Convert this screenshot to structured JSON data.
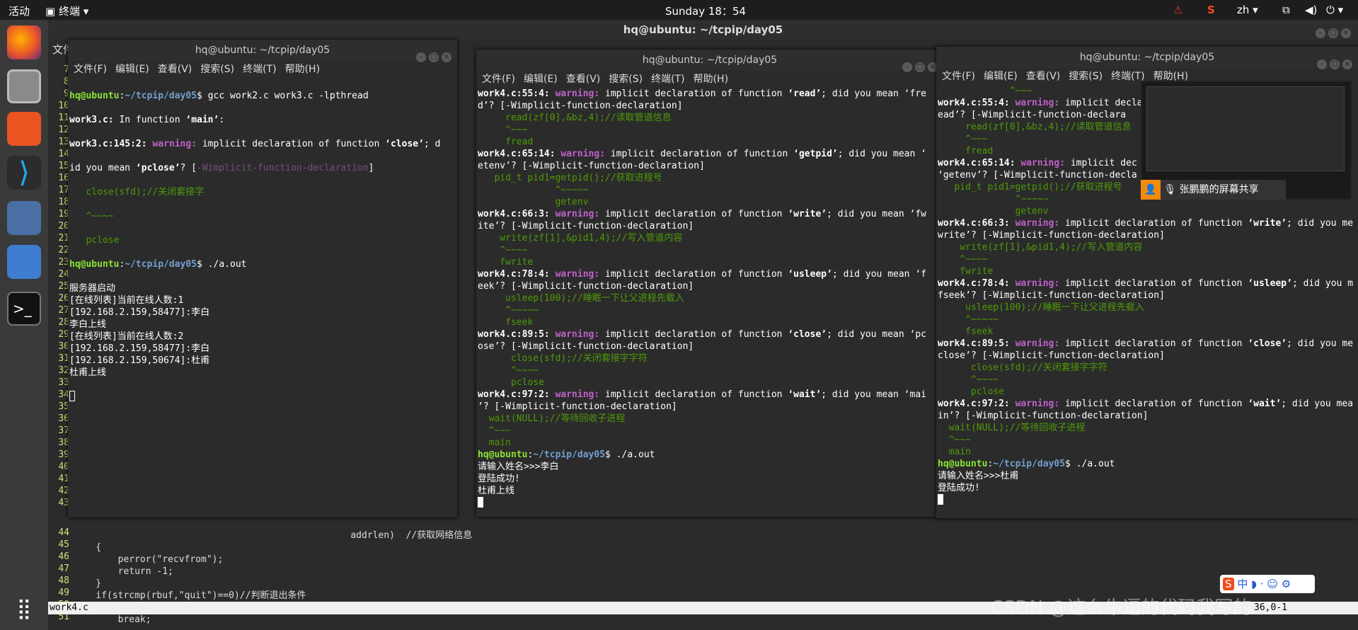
{
  "topbar": {
    "activities": "活动",
    "app": "终端",
    "clock": "Sunday 18：54",
    "lang": "zh"
  },
  "bg": {
    "title": "hq@ubuntu: ~/tcpip/day05",
    "menu_fragment": "文件",
    "status_file": "work4.c",
    "status_pos": "36,0-1",
    "gutter_top": [
      "7",
      "8",
      "9",
      "10",
      "11",
      "12",
      "13",
      "14",
      "15",
      "16",
      "17",
      "18",
      "19",
      "20",
      "21",
      "22",
      "23",
      "24",
      "25",
      "26",
      "27",
      "28",
      "29",
      "30",
      "31",
      "32",
      "33",
      "34",
      "35",
      "36",
      "37",
      "38",
      "39",
      "40",
      "41",
      "42",
      "43"
    ],
    "gutter_bottom": [
      "44",
      "45",
      "46",
      "47",
      "48",
      "49",
      "50",
      "51"
    ],
    "code": [
      "                                                  addrlen)  //获取网络信息",
      "    {",
      "        perror(\"recvfrom\");",
      "        return -1;",
      "    }",
      "    if(strcmp(rbuf,\"quit\")==0)//判断退出条件",
      "    {",
      "        break;"
    ]
  },
  "menu": [
    "文件(F)",
    "编辑(E)",
    "查看(V)",
    "搜索(S)",
    "终端(T)",
    "帮助(H)"
  ],
  "win1": {
    "title": "hq@ubuntu: ~/tcpip/day05",
    "prompt_user": "hq@ubuntu",
    "prompt_path": "~/tcpip/day05",
    "cmd1": "$ gcc work2.c work3.c -lpthread",
    "l2a": "work3.c:",
    "l2b": " In function ",
    "l2c": "‘main’",
    "l3a": "work3.c:145:2:",
    "l3b": " warning:",
    "l3c": " implicit declaration of function ",
    "l3d": "‘close’",
    "l3e": "; d",
    "l4a": "id you mean ",
    "l4b": "‘pclose’",
    "l4c": "? [",
    "l4d": "-Wimplicit-function-declaration",
    "l4e": "]",
    "l5": "   close(sfd);//关闭套接字",
    "l6": "   ^~~~~",
    "l7": "   pclose",
    "cmd2": "$ ./a.out",
    "out": [
      "服务器启动",
      "[在线列表]当前在线人数:1",
      "[192.168.2.159,58477]:李白",
      "李白上线",
      "[在线列表]当前在线人数:2",
      "[192.168.2.159,58477]:李白",
      "[192.168.2.159,50674]:杜甫",
      "杜甫上线"
    ]
  },
  "win2": {
    "title": "hq@ubuntu: ~/tcpip/day05",
    "lines": [
      {
        "a": "work4.c:55:4:",
        "b": " warning:",
        "c": " implicit declaration of function ",
        "d": "‘read’",
        "e": "; did you mean ‘fre"
      },
      {
        "t": "d’? [-Wimplicit-function-declaration]"
      },
      {
        "t": "     read(zf[0],&bz,4);//读取管道信息"
      },
      {
        "t": "     ^~~~"
      },
      {
        "t": "     fread"
      },
      {
        "a": "work4.c:65:14:",
        "b": " warning:",
        "c": " implicit declaration of function ",
        "d": "‘getpid’",
        "e": "; did you mean ‘"
      },
      {
        "t": "etenv’? [-Wimplicit-function-declaration]"
      },
      {
        "t": "   pid_t pid1=getpid();//获取进程号"
      },
      {
        "t": "              ^~~~~~"
      },
      {
        "t": "              getenv"
      },
      {
        "a": "work4.c:66:3:",
        "b": " warning:",
        "c": " implicit declaration of function ",
        "d": "‘write’",
        "e": "; did you mean ‘fw"
      },
      {
        "t": "ite’? [-Wimplicit-function-declaration]"
      },
      {
        "t": "    write(zf[1],&pid1,4);//写入管道内容"
      },
      {
        "t": "    ^~~~~"
      },
      {
        "t": "    fwrite"
      },
      {
        "a": "work4.c:78:4:",
        "b": " warning:",
        "c": " implicit declaration of function ",
        "d": "‘usleep’",
        "e": "; did you mean ‘f"
      },
      {
        "t": "eek’? [-Wimplicit-function-declaration]"
      },
      {
        "t": "     usleep(100);//睡眠一下让父进程先载入"
      },
      {
        "t": "     ^~~~~~"
      },
      {
        "t": "     fseek"
      },
      {
        "a": "work4.c:89:5:",
        "b": " warning:",
        "c": " implicit declaration of function ",
        "d": "‘close’",
        "e": "; did you mean ‘pc"
      },
      {
        "t": "ose’? [-Wimplicit-function-declaration]"
      },
      {
        "t": "      close(sfd);//关闭套接字字符"
      },
      {
        "t": "      ^~~~~"
      },
      {
        "t": "      pclose"
      },
      {
        "a": "work4.c:97:2:",
        "b": " warning:",
        "c": " implicit declaration of function ",
        "d": "‘wait’",
        "e": "; did you mean ‘mai"
      },
      {
        "t": "’? [-Wimplicit-function-declaration]"
      },
      {
        "t": "  wait(NULL);//等待回收子进程"
      },
      {
        "t": "  ^~~~"
      },
      {
        "t": "  main"
      }
    ],
    "cmd": "$ ./a.out",
    "out": [
      "请输入姓名>>>李白",
      "登陆成功!",
      "杜甫上线"
    ]
  },
  "win3": {
    "title": "hq@ubuntu: ~/tcpip/day05",
    "lines": [
      {
        "t": "             ^~~~"
      },
      {
        "a": "work4.c:55:4:",
        "b": " warning:",
        "c": " implicit decla"
      },
      {
        "t": "ead’? [-Wimplicit-function-declara"
      },
      {
        "t": "     read(zf[0],&bz,4);//读取管道信息"
      },
      {
        "t": "     ^~~~"
      },
      {
        "t": "     fread"
      },
      {
        "a": "work4.c:65:14:",
        "b": " warning:",
        "c": " implicit dec"
      },
      {
        "t": "‘getenv’? [-Wimplicit-function-decla"
      },
      {
        "t": "   pid_t pid1=getpid();//获取进程号"
      },
      {
        "t": "              ^~~~~~"
      },
      {
        "t": "              getenv"
      },
      {
        "a": "work4.c:66:3:",
        "b": " warning:",
        "c": " implicit declaration of function ",
        "d": "‘write’",
        "e": "; did you me"
      },
      {
        "t": "write’? [-Wimplicit-function-declaration]"
      },
      {
        "t": "    write(zf[1],&pid1,4);//写入管道内容"
      },
      {
        "t": "    ^~~~~"
      },
      {
        "t": "    fwrite"
      },
      {
        "a": "work4.c:78:4:",
        "b": " warning:",
        "c": " implicit declaration of function ",
        "d": "‘usleep’",
        "e": "; did you m"
      },
      {
        "t": "fseek’? [-Wimplicit-function-declaration]"
      },
      {
        "t": "     usleep(100);//睡眠一下让父进程先载入"
      },
      {
        "t": "     ^~~~~~"
      },
      {
        "t": "     fseek"
      },
      {
        "a": "work4.c:89:5:",
        "b": " warning:",
        "c": " implicit declaration of function ",
        "d": "‘close’",
        "e": "; did you me"
      },
      {
        "t": "close’? [-Wimplicit-function-declaration]"
      },
      {
        "t": "      close(sfd);//关闭套接字字符"
      },
      {
        "t": "      ^~~~~"
      },
      {
        "t": "      pclose"
      },
      {
        "a": "work4.c:97:2:",
        "b": " warning:",
        "c": " implicit declaration of function ",
        "d": "‘wait’",
        "e": "; did you mea"
      },
      {
        "t": "in’? [-Wimplicit-function-declaration]"
      },
      {
        "t": "  wait(NULL);//等待回收子进程"
      },
      {
        "t": "  ^~~~"
      },
      {
        "t": "  main"
      }
    ],
    "cmd": "$ ./a.out",
    "out": [
      "请输入姓名>>>杜甫",
      "登陆成功!"
    ]
  },
  "share": {
    "label": "张鹏鹏的屏幕共享"
  },
  "ime": {
    "label": "中 ◗ · ☺ ⚙"
  },
  "watermark": "CSDN @这么牛逼的代码我写的"
}
